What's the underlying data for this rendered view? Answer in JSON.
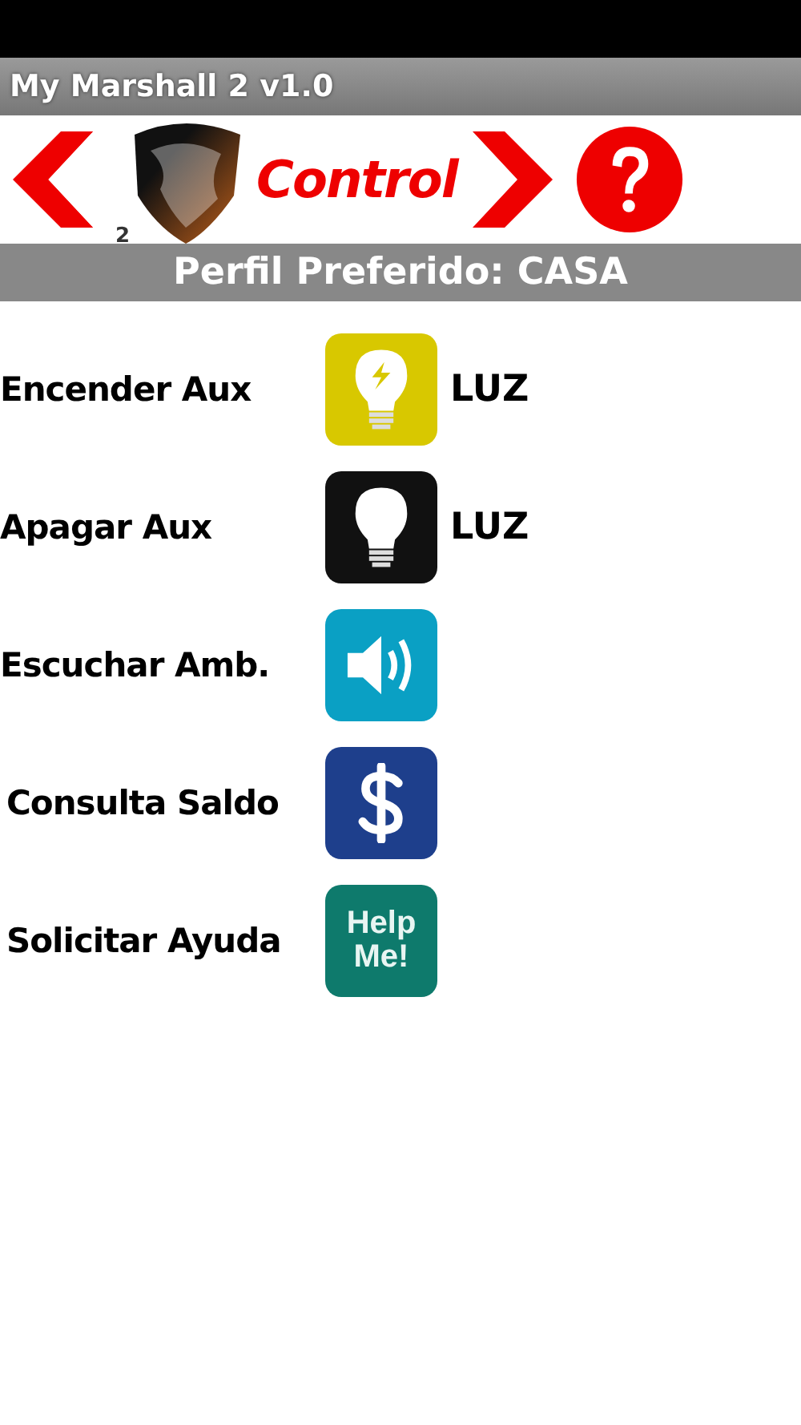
{
  "window": {
    "title": "My Marshall 2 v1.0"
  },
  "header": {
    "logo_badge": "2",
    "title": "Control"
  },
  "profile": "Perfil Preferido: CASA",
  "actions": [
    {
      "label": "Encender Aux",
      "kind": "bulb-on",
      "color": "#d8c800",
      "tag": "LUZ"
    },
    {
      "label": "Apagar Aux",
      "kind": "bulb-off",
      "color": "#111111",
      "tag": "LUZ"
    },
    {
      "label": "Escuchar Amb.",
      "kind": "speaker",
      "color": "#0aa0c4"
    },
    {
      "label": "Consulta Saldo",
      "kind": "dollar",
      "color": "#1e3f8c"
    },
    {
      "label": "Solicitar Ayuda",
      "kind": "help",
      "color": "#0e7a6c",
      "icon_text": [
        "Help",
        "Me!"
      ]
    }
  ]
}
